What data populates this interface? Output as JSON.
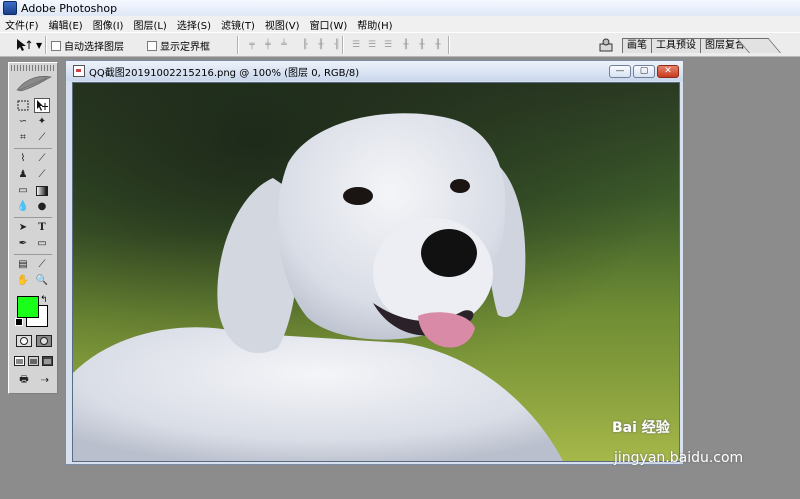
{
  "window": {
    "title": "Adobe Photoshop"
  },
  "menu": [
    "文件(F)",
    "编辑(E)",
    "图像(I)",
    "图层(L)",
    "选择(S)",
    "滤镜(T)",
    "视图(V)",
    "窗口(W)",
    "帮助(H)"
  ],
  "options": {
    "auto_select_layer": "自动选择图层",
    "show_bounding_box": "显示定界框"
  },
  "palette_tabs": [
    "画笔",
    "工具预设",
    "图层复合"
  ],
  "toolbox": {
    "foreground_color": "#1aff1a",
    "background_color": "#ffffff"
  },
  "document": {
    "title": "QQ截图20191002215216.png @ 100% (图层 0, RGB/8)"
  },
  "watermark": {
    "brand": "Bai 经验",
    "url": "jingyan.baidu.com"
  }
}
